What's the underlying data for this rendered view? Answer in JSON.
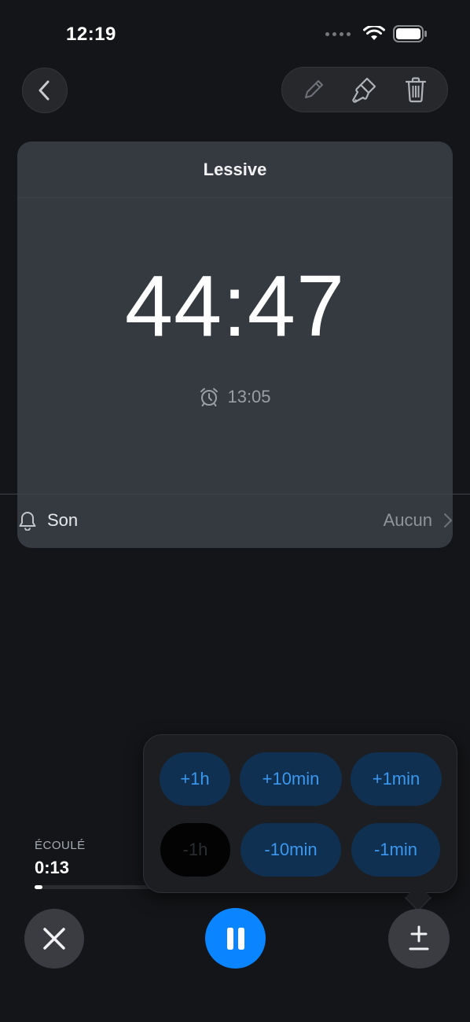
{
  "status_bar": {
    "time": "12:19",
    "icons": [
      "signal-dots-icon",
      "wifi-icon",
      "battery-icon"
    ]
  },
  "nav": {
    "back_icon": "chevron-left-icon",
    "tools": [
      "pencil-icon",
      "paintbrush-icon",
      "trash-icon"
    ]
  },
  "timer": {
    "title": "Lessive",
    "remaining": "44:47",
    "alarm_time": "13:05",
    "alarm_icon": "alarm-clock-icon",
    "sound_label": "Son",
    "sound_value": "Aucun",
    "sound_icon": "bell-icon"
  },
  "elapsed": {
    "label": "ÉCOULÉ",
    "value": "0:13",
    "progress_fraction": 0.05
  },
  "adjust": {
    "row1": [
      "+1h",
      "+10min",
      "+1min"
    ],
    "row2": [
      "-1h",
      "-10min",
      "-1min"
    ]
  },
  "controls": {
    "cancel_icon": "close-icon",
    "pause_icon": "pause-icon",
    "adjust_icon": "plus-minus-icon"
  },
  "colors": {
    "background": "#141518",
    "card": "#353a41",
    "accent": "#0a84ff",
    "adjust_button": "#0f3050",
    "adjust_text": "#3a98f0"
  }
}
